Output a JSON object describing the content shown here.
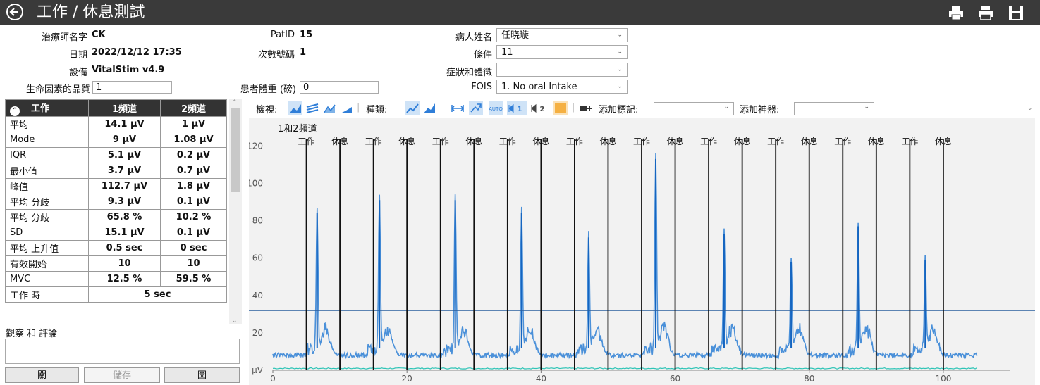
{
  "header": {
    "title": "工作 / 休息測試",
    "back_icon": "back-arrow-icon",
    "actions": [
      {
        "icon": "print-icon"
      },
      {
        "icon": "print-preview-icon"
      },
      {
        "icon": "save-disk-icon"
      }
    ]
  },
  "session": {
    "therapist_label": "治療師名字",
    "therapist": "CK",
    "date_label": "日期",
    "date": "2022/12/12 17:35",
    "device_label": "設備",
    "device": "VitalStim v4.9",
    "quality_label": "生命因素的品質",
    "quality": "1",
    "patid_label": "PatID",
    "patid": "15",
    "session_no_label": "次數號碼",
    "session_no": "1",
    "weight_label": "患者體重 (磅)",
    "weight": "0",
    "patient_name_label": "病人姓名",
    "patient_name": "任晓璇",
    "condition_label": "條件",
    "condition": "11",
    "symptoms_label": "症狀和體徵",
    "symptoms": "",
    "fois_label": "FOIS",
    "fois": "1. No oral Intake"
  },
  "stats": {
    "headers": [
      "工作",
      "1頻道",
      "2頻道"
    ],
    "rows": [
      {
        "label": "平均",
        "ch1": "14.1 µV",
        "ch2": "1 µV"
      },
      {
        "label": "Mode",
        "ch1": "9 µV",
        "ch2": "1.08 µV"
      },
      {
        "label": "IQR",
        "ch1": "5.1 µV",
        "ch2": "0.2 µV"
      },
      {
        "label": "最小值",
        "ch1": "3.7 µV",
        "ch2": "0.7 µV"
      },
      {
        "label": "峰值",
        "ch1": "112.7 µV",
        "ch2": "1.8 µV"
      },
      {
        "label": "平均 分歧",
        "ch1": "9.3 µV",
        "ch2": "0.1 µV"
      },
      {
        "label": "平均 分歧",
        "ch1": "65.8 %",
        "ch2": "10.2 %"
      },
      {
        "label": "SD",
        "ch1": "15.1 µV",
        "ch2": "0.1 µV"
      },
      {
        "label": "平均 上升值",
        "ch1": "0.5 sec",
        "ch2": "0 sec"
      },
      {
        "label": "有效開始",
        "ch1": "10",
        "ch2": "10"
      },
      {
        "label": "MVC",
        "ch1": "12.5 %",
        "ch2": "59.5 %"
      }
    ],
    "work_time_label": "工作 時",
    "work_time": "5 sec"
  },
  "observations": {
    "label": "觀察 和 評論",
    "text": ""
  },
  "buttons": {
    "close": "關",
    "save": "儲存",
    "graph": "圖"
  },
  "toolbar": {
    "view_label": "檢視:",
    "type_label": "種類:",
    "add_marker_label": "添加標記:",
    "add_artifact_label": "添加神器:",
    "marker_value": "",
    "artifact_value": "",
    "ch1_toggle": "1",
    "ch2_toggle": "2"
  },
  "colors": {
    "titlebar": "#3a3a3a",
    "ch1": "#1565c0",
    "ch1_light": "#4a90d9",
    "ch2": "#2ec4b6",
    "threshold": "#2a5f9e",
    "marker": "#111111",
    "accent": "#f5b042"
  },
  "chart_data": {
    "type": "line",
    "title": "1和2頻道",
    "xlabel": "",
    "ylabel": "µV",
    "xlim": [
      0,
      110
    ],
    "ylim": [
      0,
      125
    ],
    "xticks": [
      0,
      20,
      40,
      60,
      80,
      100
    ],
    "yticks": [
      0,
      20,
      40,
      60,
      80,
      100,
      120
    ],
    "ytick_labels": [
      "0 µV",
      "20",
      "40",
      "60",
      "80",
      "100",
      "120"
    ],
    "threshold": 32,
    "markers": [
      {
        "x": 5,
        "label": "工作"
      },
      {
        "x": 10,
        "label": "休息"
      },
      {
        "x": 15,
        "label": "工作"
      },
      {
        "x": 20,
        "label": "休息"
      },
      {
        "x": 25,
        "label": "工作"
      },
      {
        "x": 30,
        "label": "休息"
      },
      {
        "x": 35,
        "label": "工作"
      },
      {
        "x": 40,
        "label": "休息"
      },
      {
        "x": 45,
        "label": "工作"
      },
      {
        "x": 50,
        "label": "休息"
      },
      {
        "x": 55,
        "label": "工作"
      },
      {
        "x": 60,
        "label": "休息"
      },
      {
        "x": 65,
        "label": "工作"
      },
      {
        "x": 70,
        "label": "休息"
      },
      {
        "x": 75,
        "label": "工作"
      },
      {
        "x": 80,
        "label": "休息"
      },
      {
        "x": 85,
        "label": "工作"
      },
      {
        "x": 90,
        "label": "休息"
      },
      {
        "x": 95,
        "label": "工作"
      },
      {
        "x": 100,
        "label": "休息"
      }
    ],
    "peaks": [
      {
        "x": 6.6,
        "y": 84
      },
      {
        "x": 15.9,
        "y": 91
      },
      {
        "x": 27.2,
        "y": 91
      },
      {
        "x": 37.1,
        "y": 84
      },
      {
        "x": 47.1,
        "y": 71
      },
      {
        "x": 57.1,
        "y": 113
      },
      {
        "x": 67.3,
        "y": 73
      },
      {
        "x": 77.3,
        "y": 58
      },
      {
        "x": 87.3,
        "y": 77
      },
      {
        "x": 97.3,
        "y": 59
      }
    ],
    "series": [
      {
        "name": "1頻道",
        "baseline": 8,
        "xmax": 105
      },
      {
        "name": "2頻道",
        "baseline": 1,
        "xmax": 105
      }
    ]
  }
}
